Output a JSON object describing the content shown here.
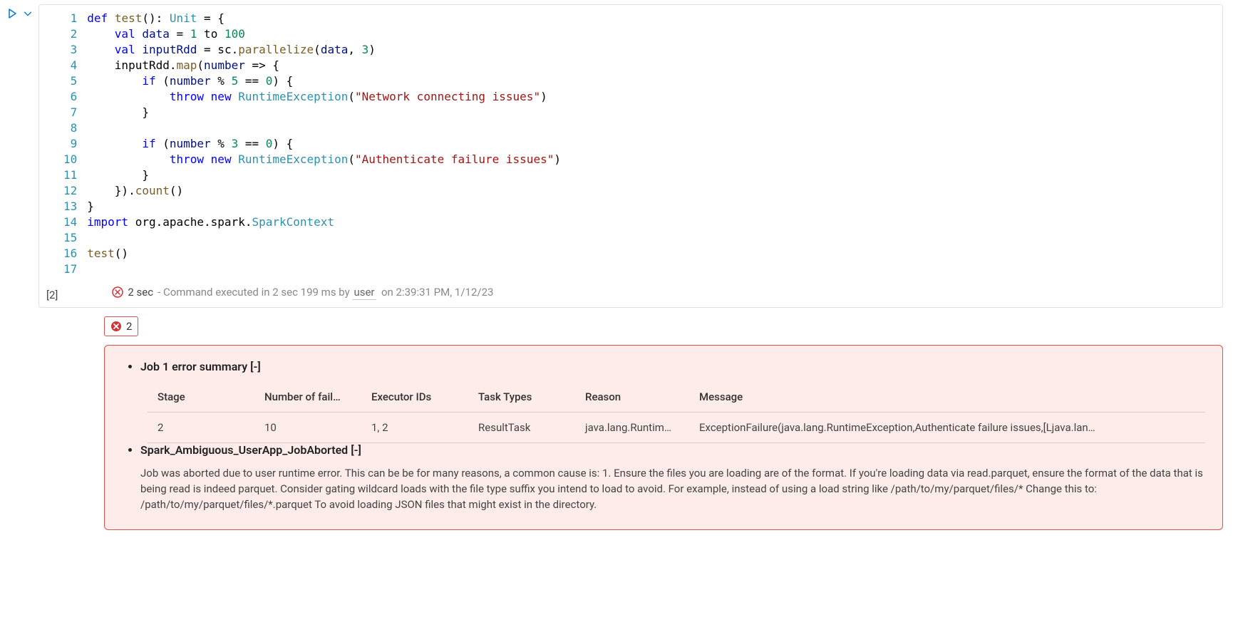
{
  "cell": {
    "exec_count_label": "[2]",
    "line_numbers": [
      "1",
      "2",
      "3",
      "4",
      "5",
      "6",
      "7",
      "8",
      "9",
      "10",
      "11",
      "12",
      "13",
      "14",
      "15",
      "16",
      "17"
    ],
    "code_tokens": [
      [
        {
          "t": "kw",
          "v": "def"
        },
        {
          "t": "op",
          "v": " "
        },
        {
          "t": "fn",
          "v": "test"
        },
        {
          "t": "op",
          "v": "(): "
        },
        {
          "t": "type",
          "v": "Unit"
        },
        {
          "t": "op",
          "v": " = {"
        }
      ],
      [
        {
          "t": "op",
          "v": "    "
        },
        {
          "t": "kw",
          "v": "val"
        },
        {
          "t": "op",
          "v": " "
        },
        {
          "t": "ident",
          "v": "data"
        },
        {
          "t": "op",
          "v": " = "
        },
        {
          "t": "num",
          "v": "1"
        },
        {
          "t": "op",
          "v": " to "
        },
        {
          "t": "num",
          "v": "100"
        }
      ],
      [
        {
          "t": "op",
          "v": "    "
        },
        {
          "t": "kw",
          "v": "val"
        },
        {
          "t": "op",
          "v": " "
        },
        {
          "t": "ident",
          "v": "inputRdd"
        },
        {
          "t": "op",
          "v": " = sc."
        },
        {
          "t": "fn",
          "v": "parallelize"
        },
        {
          "t": "op",
          "v": "("
        },
        {
          "t": "ident",
          "v": "data"
        },
        {
          "t": "op",
          "v": ", "
        },
        {
          "t": "num",
          "v": "3"
        },
        {
          "t": "op",
          "v": ")"
        }
      ],
      [
        {
          "t": "op",
          "v": "    inputRdd."
        },
        {
          "t": "fn",
          "v": "map"
        },
        {
          "t": "op",
          "v": "("
        },
        {
          "t": "ident",
          "v": "number"
        },
        {
          "t": "op",
          "v": " => {"
        }
      ],
      [
        {
          "t": "op",
          "v": "        "
        },
        {
          "t": "kw",
          "v": "if"
        },
        {
          "t": "op",
          "v": " ("
        },
        {
          "t": "ident",
          "v": "number"
        },
        {
          "t": "op",
          "v": " % "
        },
        {
          "t": "num",
          "v": "5"
        },
        {
          "t": "op",
          "v": " == "
        },
        {
          "t": "num",
          "v": "0"
        },
        {
          "t": "op",
          "v": ") {"
        }
      ],
      [
        {
          "t": "op",
          "v": "            "
        },
        {
          "t": "kw",
          "v": "throw"
        },
        {
          "t": "op",
          "v": " "
        },
        {
          "t": "kw",
          "v": "new"
        },
        {
          "t": "op",
          "v": " "
        },
        {
          "t": "type",
          "v": "RuntimeException"
        },
        {
          "t": "op",
          "v": "("
        },
        {
          "t": "str",
          "v": "\"Network connecting issues\""
        },
        {
          "t": "op",
          "v": ")"
        }
      ],
      [
        {
          "t": "op",
          "v": "        }"
        }
      ],
      [
        {
          "t": "op",
          "v": ""
        }
      ],
      [
        {
          "t": "op",
          "v": "        "
        },
        {
          "t": "kw",
          "v": "if"
        },
        {
          "t": "op",
          "v": " ("
        },
        {
          "t": "ident",
          "v": "number"
        },
        {
          "t": "op",
          "v": " % "
        },
        {
          "t": "num",
          "v": "3"
        },
        {
          "t": "op",
          "v": " == "
        },
        {
          "t": "num",
          "v": "0"
        },
        {
          "t": "op",
          "v": ") {"
        }
      ],
      [
        {
          "t": "op",
          "v": "            "
        },
        {
          "t": "kw",
          "v": "throw"
        },
        {
          "t": "op",
          "v": " "
        },
        {
          "t": "kw",
          "v": "new"
        },
        {
          "t": "op",
          "v": " "
        },
        {
          "t": "type",
          "v": "RuntimeException"
        },
        {
          "t": "op",
          "v": "("
        },
        {
          "t": "str",
          "v": "\"Authenticate failure issues\""
        },
        {
          "t": "op",
          "v": ")"
        }
      ],
      [
        {
          "t": "op",
          "v": "        }"
        }
      ],
      [
        {
          "t": "op",
          "v": "    })."
        },
        {
          "t": "fn",
          "v": "count"
        },
        {
          "t": "op",
          "v": "()"
        }
      ],
      [
        {
          "t": "op",
          "v": "}"
        }
      ],
      [
        {
          "t": "kw",
          "v": "import"
        },
        {
          "t": "op",
          "v": " org.apache.spark."
        },
        {
          "t": "type",
          "v": "SparkContext"
        }
      ],
      [
        {
          "t": "op",
          "v": ""
        }
      ],
      [
        {
          "t": "fn",
          "v": "test"
        },
        {
          "t": "op",
          "v": "()"
        }
      ],
      [
        {
          "t": "op",
          "v": ""
        }
      ]
    ]
  },
  "exec": {
    "duration": "2 sec",
    "sep": " - ",
    "detail_prefix": "Command executed in 2 sec 199 ms by",
    "user": "user",
    "when": "on 2:39:31 PM, 1/12/23"
  },
  "error": {
    "count": "2",
    "summary_title": "Job 1 error summary",
    "collapse_symbol": "[-]",
    "table": {
      "headers": {
        "stage": "Stage",
        "fail": "Number of fail…",
        "exec": "Executor IDs",
        "type": "Task Types",
        "reason": "Reason",
        "msg": "Message"
      },
      "row": {
        "stage": "2",
        "fail": "10",
        "exec": "1, 2",
        "type": "ResultTask",
        "reason": "java.lang.Runtim…",
        "msg": "ExceptionFailure(java.lang.RuntimeException,Authenticate failure issues,[Ljava.lan…"
      }
    },
    "aborted_title": "Spark_Ambiguous_UserApp_JobAborted",
    "aborted_desc": "Job was aborted due to user runtime error. This can be be for many reasons, a common cause is: 1. Ensure the files you are loading are of the format. If you're loading data via read.parquet, ensure the format of the data that is being read is indeed parquet. Consider gating wildcard loads with the file type suffix you intend to load to avoid. For example, instead of using a load string like /path/to/my/parquet/files/* Change this to: /path/to/my/parquet/files/*.parquet To avoid loading JSON files that might exist in the directory."
  }
}
